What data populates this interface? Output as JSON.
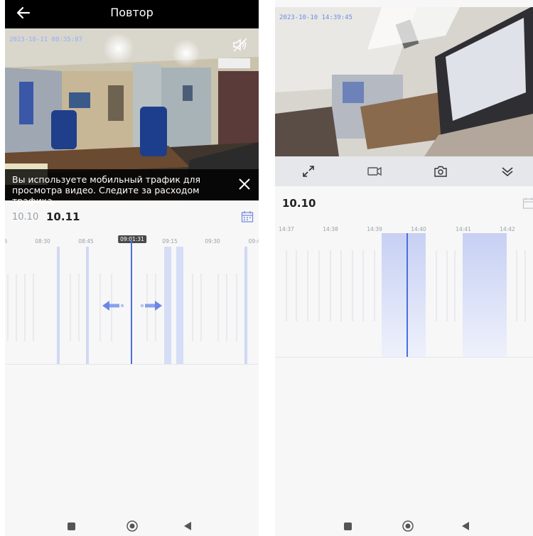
{
  "left": {
    "header": {
      "title": "Повтор"
    },
    "video": {
      "timestamp": "2023-10-11 08:35:07"
    },
    "notice": {
      "text": "Вы используете мобильный трафик для просмотра видео. Следите за расходом трафика."
    },
    "dates": {
      "previous": "10.10",
      "current": "10.11"
    },
    "timeline": {
      "labels": [
        "5",
        "08:30",
        "08:45",
        "09:15",
        "09:30",
        "09:4"
      ],
      "cursor_time": "09:01:31"
    }
  },
  "right": {
    "video": {
      "timestamp": "2023-10-10 14:39:45"
    },
    "controls": [
      "fullscreen-icon",
      "record-icon",
      "camera-icon",
      "collapse-icon"
    ],
    "dates": {
      "current": "10.10"
    },
    "timeline": {
      "labels": [
        "14:37",
        "14:38",
        "14:39",
        "14:40",
        "14:41",
        "14:42"
      ]
    }
  },
  "colors": {
    "accent": "#4a6ee0",
    "segment": "#c8d1f3",
    "notice_bg": "#000000"
  }
}
